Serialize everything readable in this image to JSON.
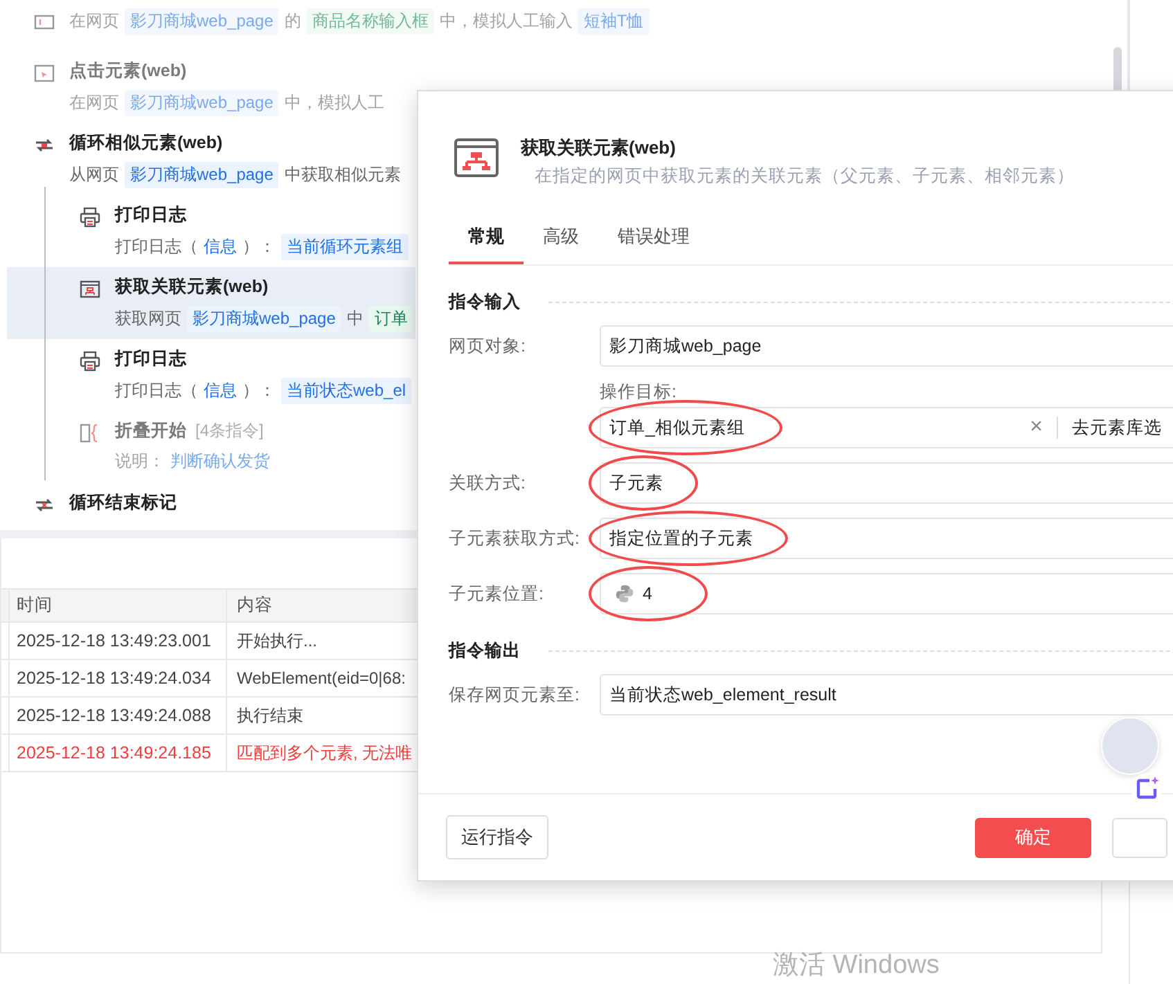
{
  "workflow": {
    "steps": [
      {
        "kind": "input",
        "disabled": true,
        "selected": false,
        "desc": [
          {
            "text": "在网页",
            "kind": "plain"
          },
          {
            "text": "影刀商城web_page",
            "kind": "variable"
          },
          {
            "text": "的",
            "kind": "plain"
          },
          {
            "text": "商品名称输入框",
            "kind": "element"
          },
          {
            "text": "中，模拟人工输入",
            "kind": "plain"
          },
          {
            "text": "短袖T恤",
            "kind": "variable"
          }
        ]
      },
      {
        "title": "点击元素(web)",
        "kind": "click",
        "disabled": true,
        "selected": false,
        "desc": [
          {
            "text": "在网页",
            "kind": "plain"
          },
          {
            "text": "影刀商城web_page",
            "kind": "variable"
          },
          {
            "text": "中，模拟人工",
            "kind": "plain"
          }
        ]
      },
      {
        "title": "循环相似元素(web)",
        "kind": "loop",
        "disabled": false,
        "selected": false,
        "desc": [
          {
            "text": "从网页",
            "kind": "plain"
          },
          {
            "text": "影刀商城web_page",
            "kind": "variable"
          },
          {
            "text": "中获取相似元素",
            "kind": "plain"
          }
        ],
        "children": [
          {
            "title": "打印日志",
            "kind": "print",
            "disabled": false,
            "selected": false,
            "desc": [
              {
                "text": "打印日志（",
                "kind": "plain"
              },
              {
                "text": "信息",
                "kind": "keyword"
              },
              {
                "text": "）：",
                "kind": "plain"
              },
              {
                "text": "当前循环元素组",
                "kind": "variable"
              }
            ]
          },
          {
            "title": "获取关联元素(web)",
            "kind": "element",
            "disabled": false,
            "selected": true,
            "desc": [
              {
                "text": "获取网页",
                "kind": "plain"
              },
              {
                "text": "影刀商城web_page",
                "kind": "variable"
              },
              {
                "text": "中",
                "kind": "plain"
              },
              {
                "text": "订单",
                "kind": "element"
              }
            ]
          },
          {
            "title": "打印日志",
            "kind": "print",
            "disabled": false,
            "selected": false,
            "desc": [
              {
                "text": "打印日志（",
                "kind": "plain"
              },
              {
                "text": "信息",
                "kind": "keyword"
              },
              {
                "text": "）：",
                "kind": "plain"
              },
              {
                "text": "当前状态web_el",
                "kind": "variable"
              }
            ]
          },
          {
            "title": "折叠开始",
            "note": "[4条指令]",
            "kind": "fold",
            "disabled": true,
            "selected": false,
            "desc": [
              {
                "text": "说明：",
                "kind": "plain"
              },
              {
                "text": "判断确认发货",
                "kind": "keyword"
              }
            ]
          }
        ]
      },
      {
        "title": "循环结束标记",
        "kind": "loop-end",
        "disabled": false,
        "selected": false
      }
    ]
  },
  "log": {
    "columns": [
      "时间",
      "内容"
    ],
    "rows": [
      {
        "time": "2025-12-18 13:49:23.001",
        "content": "开始执行...",
        "error": false
      },
      {
        "time": "2025-12-18 13:49:24.034",
        "content": "WebElement(eid=0|68:",
        "error": false
      },
      {
        "time": "2025-12-18 13:49:24.088",
        "content": "执行结束",
        "error": false
      },
      {
        "time": "2025-12-18 13:49:24.185",
        "content": "匹配到多个元素, 无法唯",
        "error": true
      }
    ]
  },
  "dialog": {
    "title": "获取关联元素(web)",
    "subtitle": "在指定的网页中获取元素的关联元素（父元素、子元素、相邻元素）",
    "tabs": [
      {
        "label": "常规",
        "selected": true
      },
      {
        "label": "高级",
        "selected": false
      },
      {
        "label": "错误处理",
        "selected": false
      }
    ],
    "sections": [
      {
        "heading": "指令输入",
        "fields": [
          {
            "kind": "select",
            "label": "网页对象:",
            "value": "影刀商城web_page"
          },
          {
            "kind": "element",
            "label": "操作目标:",
            "value": "订单_相似元素组",
            "clear": "×",
            "picker": "去元素库选",
            "circled": true
          },
          {
            "kind": "select",
            "label": "关联方式:",
            "value": "子元素",
            "circled": true
          },
          {
            "kind": "select",
            "label": "子元素获取方式:",
            "value": "指定位置的子元素",
            "circled": true
          },
          {
            "kind": "python",
            "label": "子元素位置:",
            "value": "4",
            "circled": true
          }
        ]
      },
      {
        "heading": "指令输出",
        "fields": [
          {
            "kind": "select",
            "label": "保存网页元素至:",
            "value": "当前状态web_element_result"
          }
        ]
      }
    ],
    "run_button": "运行指令",
    "ok_button": "确定"
  },
  "system_text": "激活 Windows"
}
